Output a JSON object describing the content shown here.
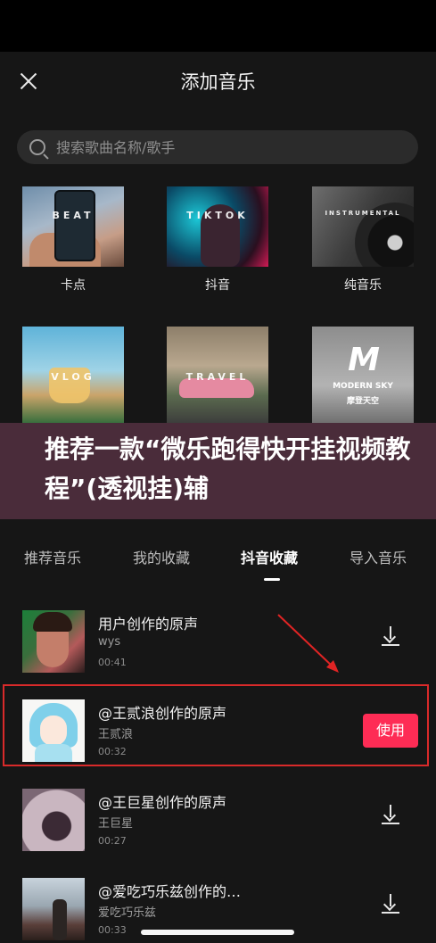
{
  "header": {
    "title": "添加音乐"
  },
  "search": {
    "placeholder": "搜索歌曲名称/歌手"
  },
  "categories": [
    {
      "label": "卡点",
      "cover_text": "BEAT"
    },
    {
      "label": "抖音",
      "cover_text": "TIKTOK"
    },
    {
      "label": "纯音乐",
      "cover_text": "INSTRUMENTAL"
    },
    {
      "label": "",
      "cover_text": "VLOG"
    },
    {
      "label": "",
      "cover_text": "TRAVEL"
    },
    {
      "label": "",
      "cover_text": "MODERN SKY",
      "cover_subtext": "摩登天空"
    }
  ],
  "banner": {
    "text": "推荐一款“微乐跑得快开挂视频教程”(透视挂)辅"
  },
  "tabs": [
    {
      "label": "推荐音乐",
      "active": false
    },
    {
      "label": "我的收藏",
      "active": false
    },
    {
      "label": "抖音收藏",
      "active": true
    },
    {
      "label": "导入音乐",
      "active": false
    }
  ],
  "songs": [
    {
      "title": "用户创作的原声",
      "artist": "wys",
      "duration": "00:41",
      "action": "download"
    },
    {
      "title": "@王贰浪创作的原声",
      "artist": "王贰浪",
      "duration": "00:32",
      "action": "use"
    },
    {
      "title": "@王巨星创作的原声",
      "artist": "王巨星",
      "duration": "00:27",
      "action": "download"
    },
    {
      "title": "@爱吃巧乐兹创作的…",
      "artist": "爱吃巧乐兹",
      "duration": "00:33",
      "action": "download"
    }
  ],
  "use_button_label": "使用",
  "colors": {
    "accent": "#fe2c55",
    "highlight": "#d92a2a",
    "background": "#161616"
  }
}
